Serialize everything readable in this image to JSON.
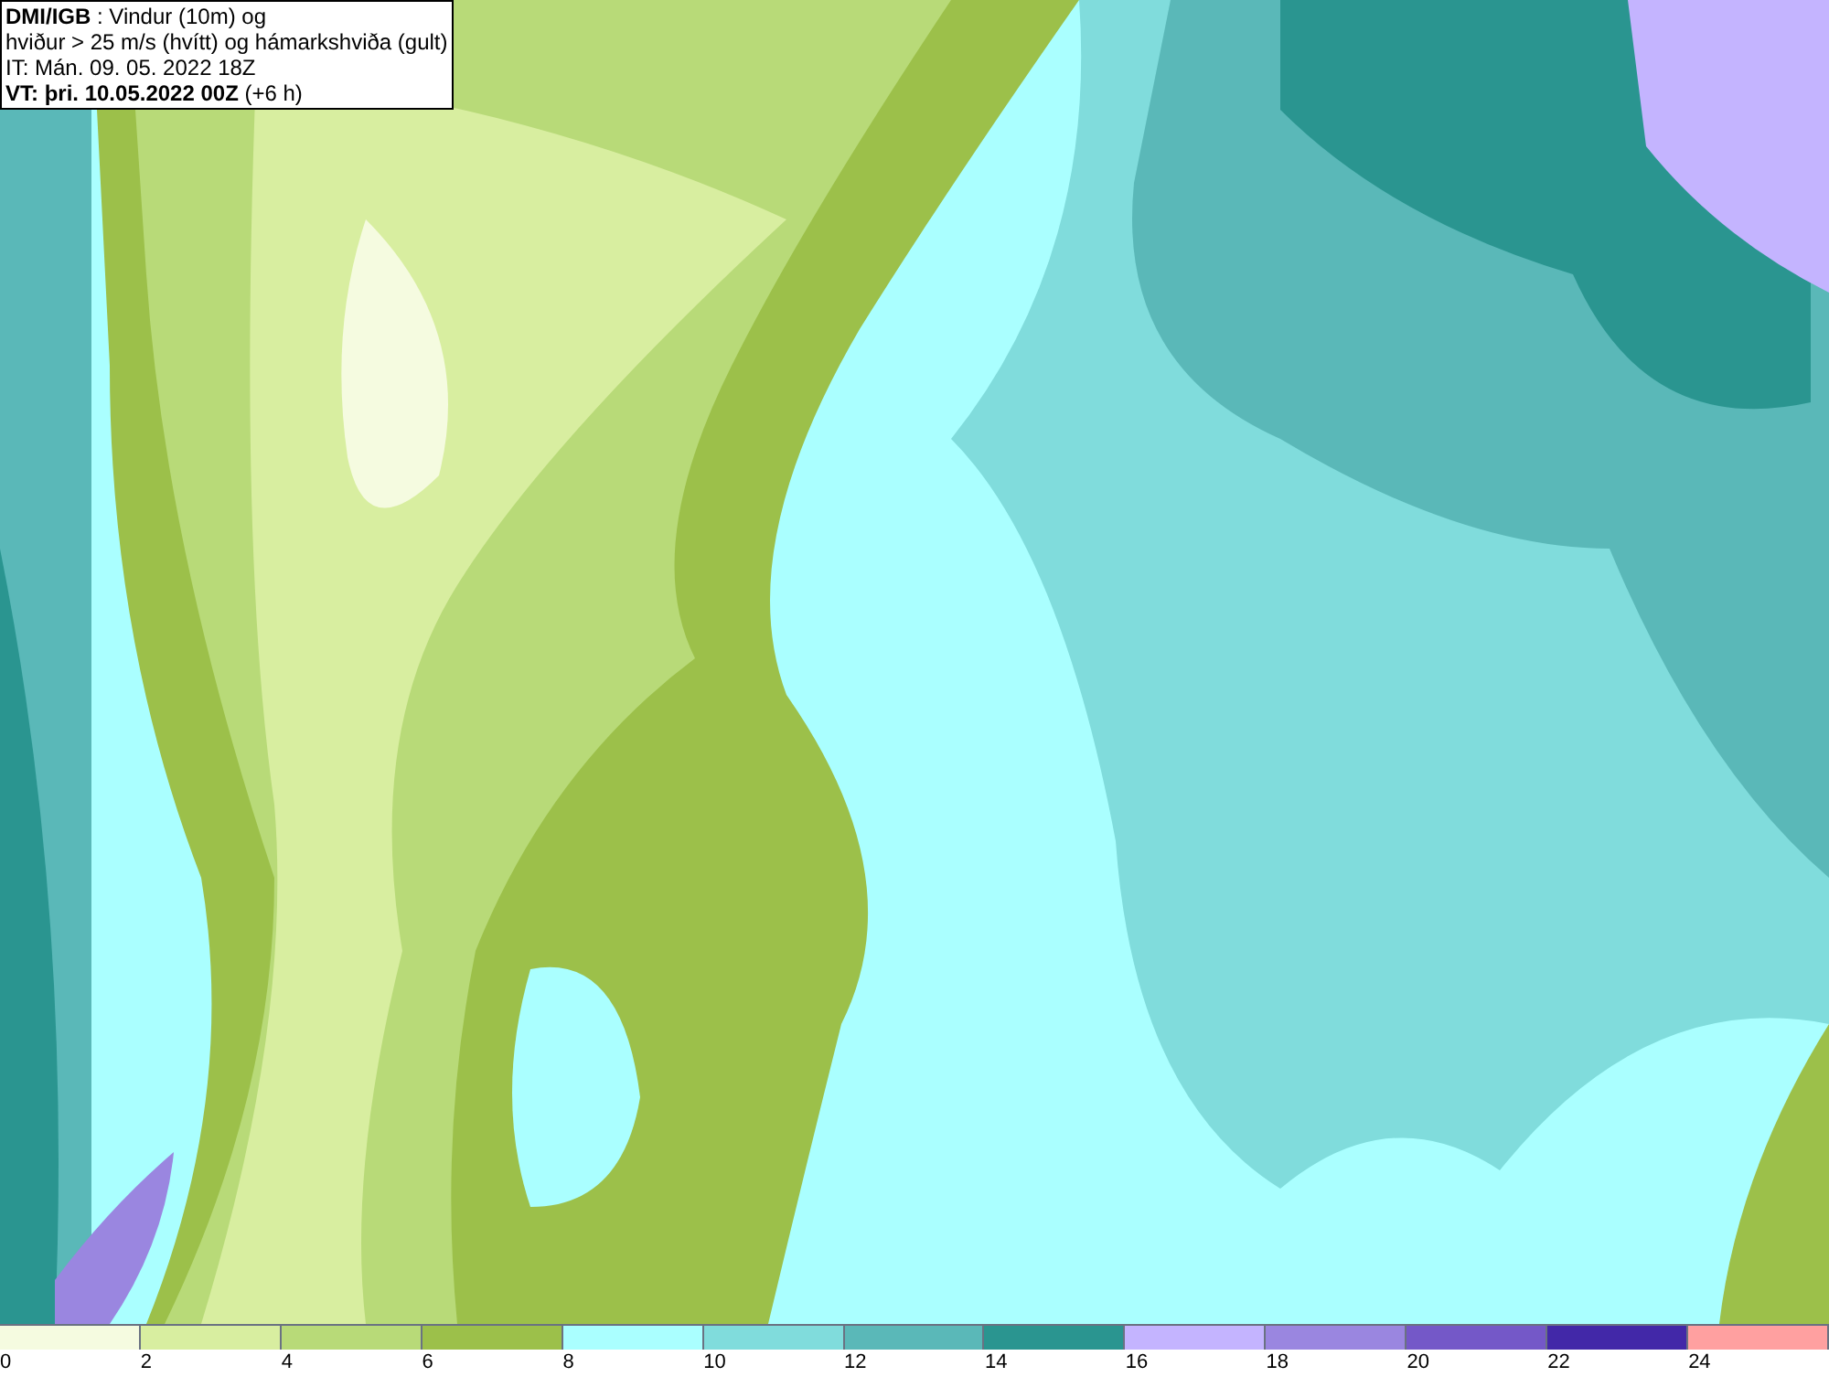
{
  "title_box": {
    "lines": [
      "**DMI/IGB** : Vindur (10m) og",
      "hviður > 25 m/s (hvítt) og hámarkshviða (gult)",
      "IT: Mán. 09. 05. 2022 18Z",
      "**VT: þri. 10.05.2022 00Z** (+6 h)"
    ]
  },
  "legend": {
    "swatches": [
      {
        "color": "#f5fbe0"
      },
      {
        "color": "#d8eea0"
      },
      {
        "color": "#b8da78"
      },
      {
        "color": "#9cc04a"
      },
      {
        "color": "#aaffff"
      },
      {
        "color": "#80dcdc"
      },
      {
        "color": "#5ab8b8"
      },
      {
        "color": "#2a9590"
      },
      {
        "color": "#c4b4ff"
      },
      {
        "color": "#9a86e0"
      },
      {
        "color": "#7458c8"
      },
      {
        "color": "#4228a8"
      },
      {
        "color": "#ffa0a0"
      }
    ],
    "labels": [
      "0",
      "2",
      "4",
      "6",
      "8",
      "10",
      "12",
      "14",
      "16",
      "18",
      "20",
      "22",
      "24"
    ]
  }
}
